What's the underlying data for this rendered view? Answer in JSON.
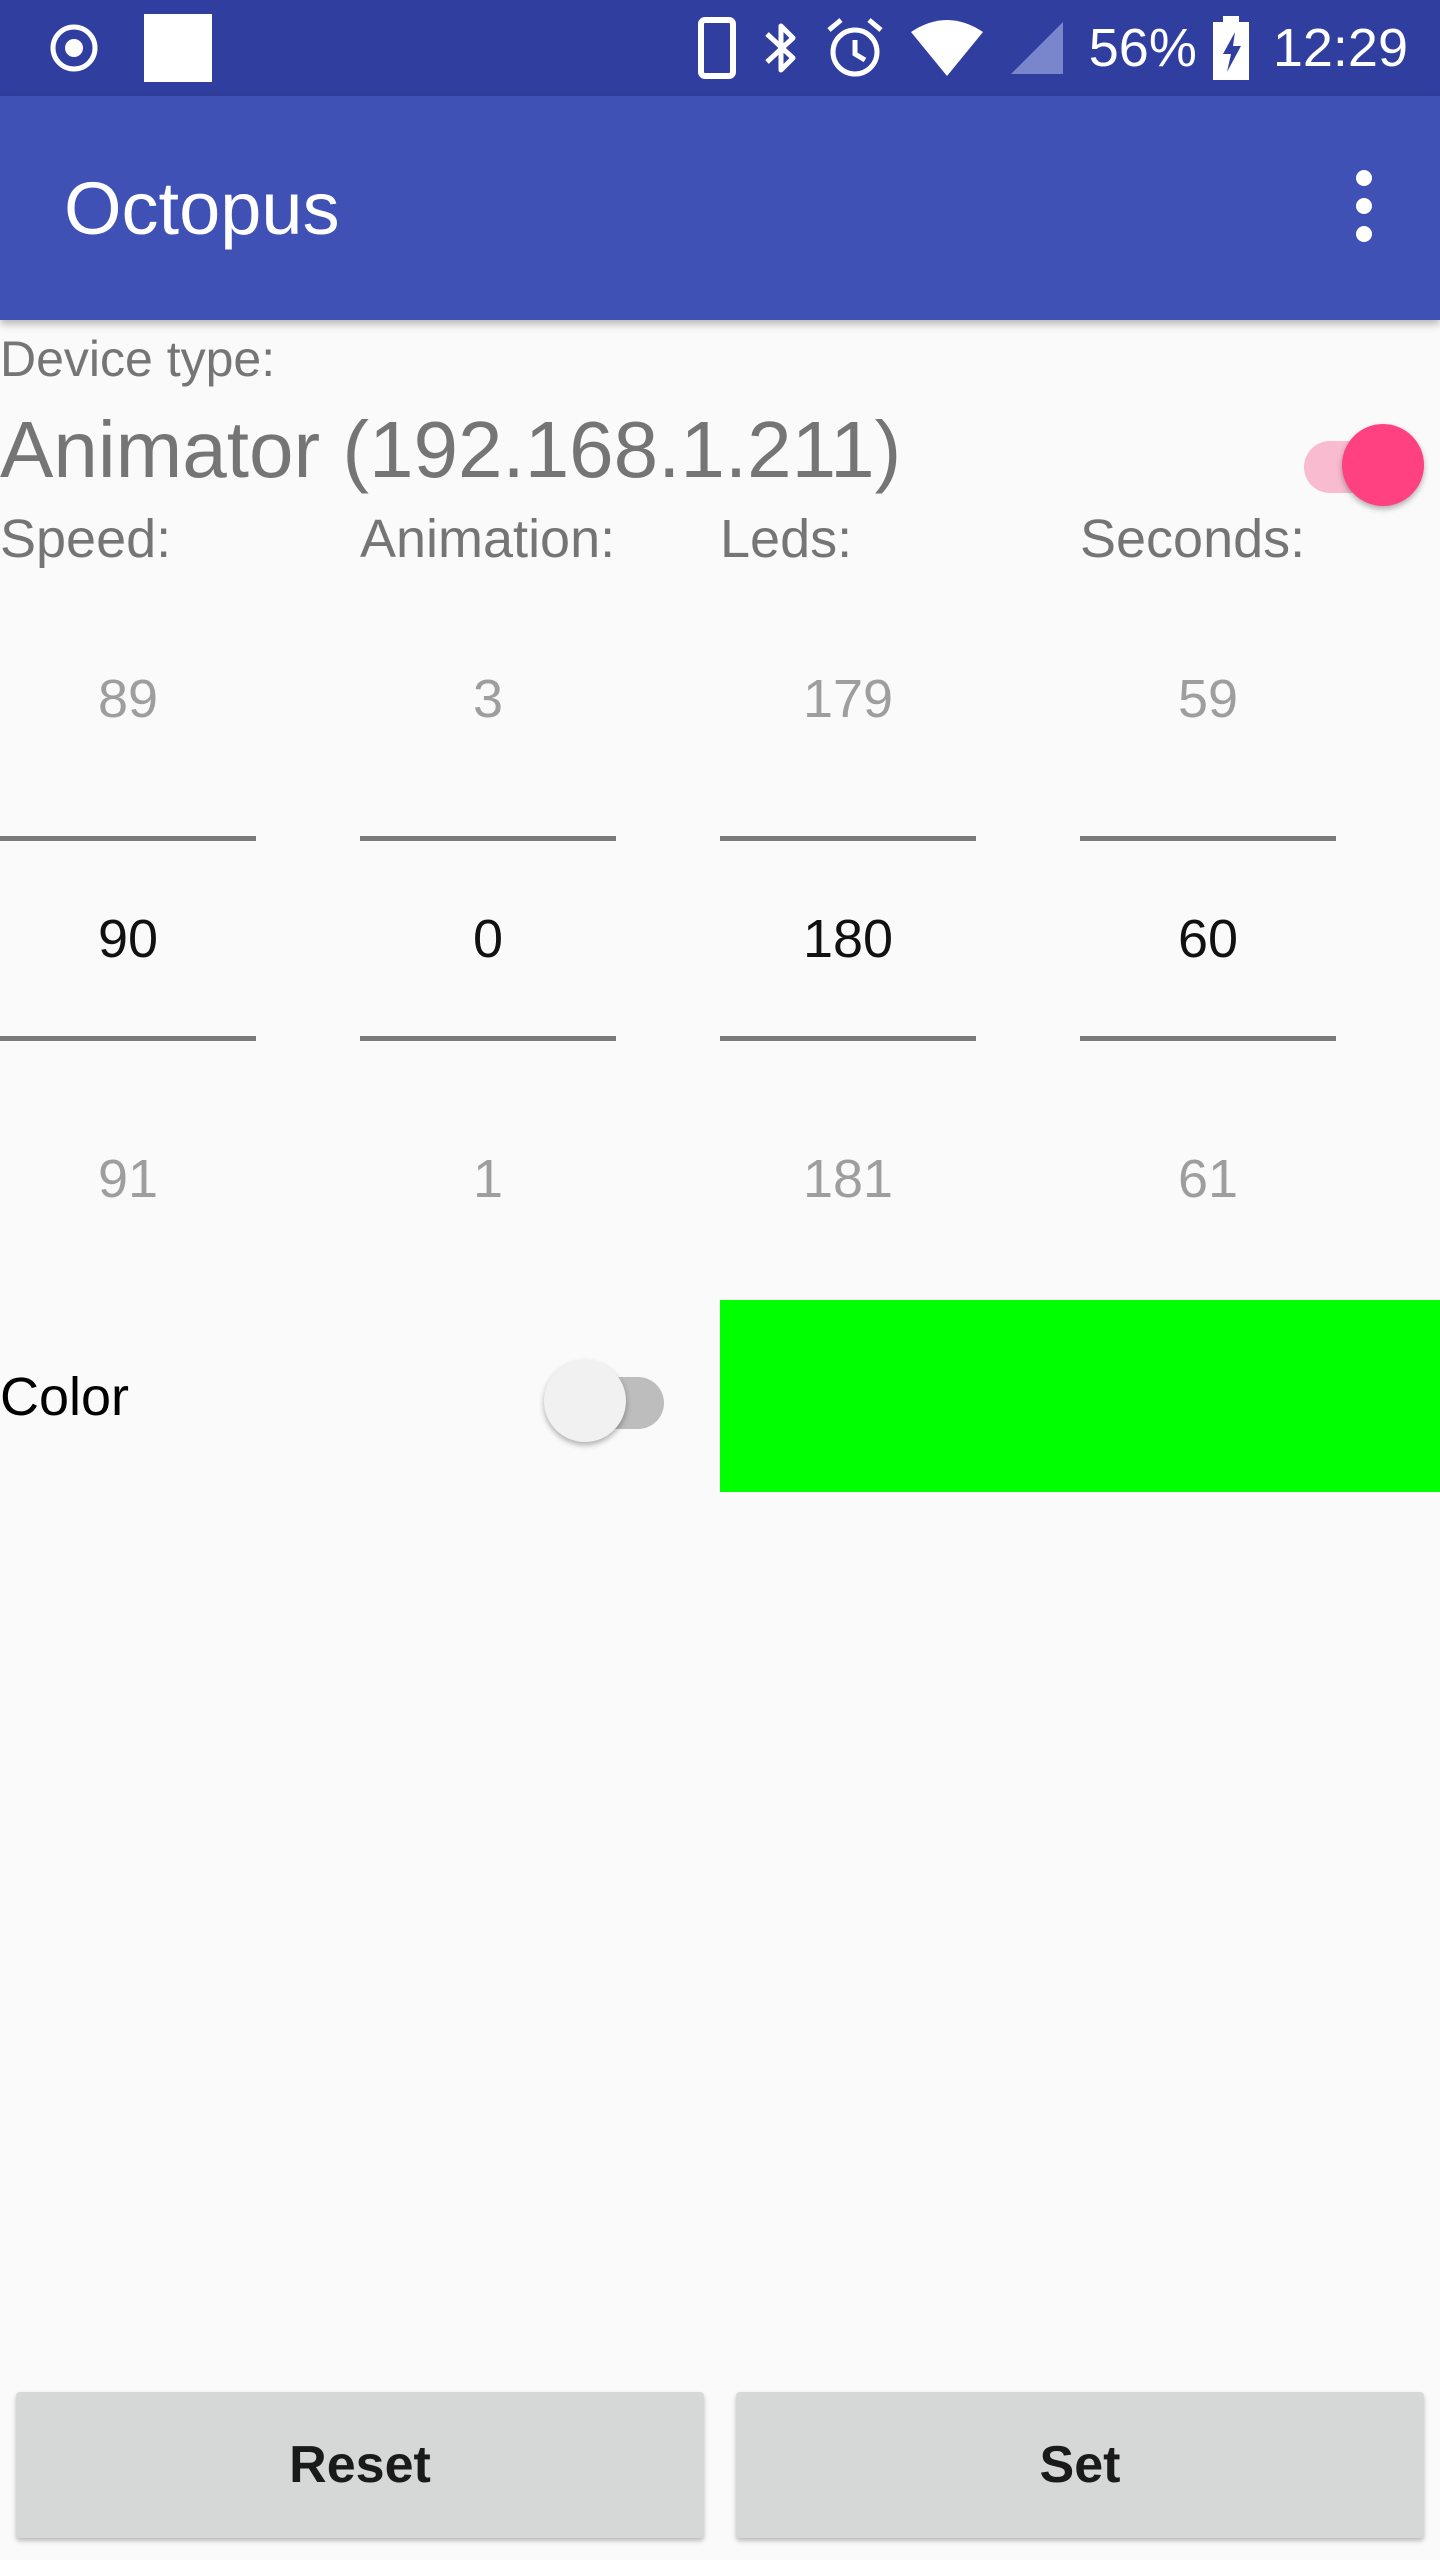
{
  "status_bar": {
    "battery_percent": "56%",
    "time": "12:29",
    "icons": [
      "record-icon",
      "square-notification-icon",
      "phone-vibrate-icon",
      "bluetooth-icon",
      "alarm-icon",
      "wifi-icon",
      "cell-signal-icon",
      "battery-charging-icon"
    ]
  },
  "app_bar": {
    "title": "Octopus",
    "overflow_icon": "more-vert-icon"
  },
  "device": {
    "type_label": "Device type:",
    "name": "Animator (192.168.1.211)",
    "enabled": true
  },
  "pickers": [
    {
      "label": "Speed:",
      "prev": "89",
      "current": "90",
      "next": "91"
    },
    {
      "label": "Animation:",
      "prev": "3",
      "current": "0",
      "next": "1"
    },
    {
      "label": "Leds:",
      "prev": "179",
      "current": "180",
      "next": "181"
    },
    {
      "label": "Seconds:",
      "prev": "59",
      "current": "60",
      "next": "61"
    }
  ],
  "color": {
    "label": "Color",
    "enabled": false,
    "swatch": "#00ff00"
  },
  "buttons": {
    "reset": "Reset",
    "set": "Set"
  },
  "colors": {
    "status_bar": "#303f9f",
    "app_bar": "#3f51b5",
    "accent": "#ff4081",
    "background": "#fafafa"
  }
}
